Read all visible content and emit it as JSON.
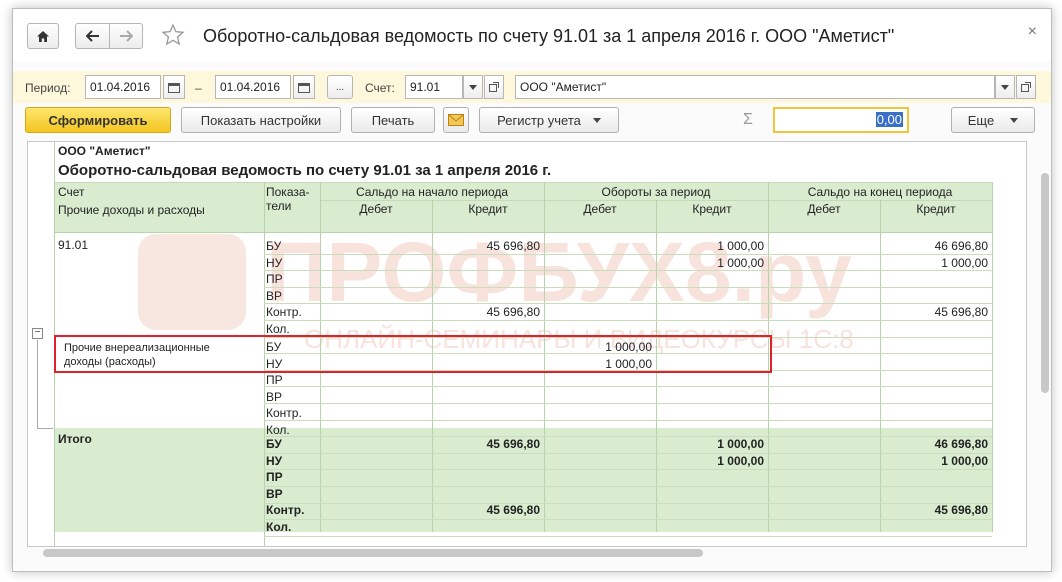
{
  "window": {
    "title": "Оборотно-сальдовая ведомость по счету 91.01 за 1 апреля 2016 г. ООО \"Аметист\""
  },
  "params": {
    "period_label": "Период:",
    "date_from": "01.04.2016",
    "dash": "–",
    "date_to": "01.04.2016",
    "ellipsis": "...",
    "account_label": "Счет:",
    "account_value": "91.01",
    "org_value": "ООО \"Аметист\""
  },
  "toolbar": {
    "generate": "Сформировать",
    "show_settings": "Показать настройки",
    "print": "Печать",
    "register": "Регистр учета",
    "sigma": "Σ",
    "sum_value": "0,00",
    "more": "Еще"
  },
  "report": {
    "org": "ООО \"Аметист\"",
    "title": "Оборотно-сальдовая ведомость по счету 91.01 за 1 апреля 2016 г.",
    "headers": {
      "account": "Счет",
      "subconto": "Прочие доходы и расходы",
      "indicators_1": "Показа-",
      "indicators_2": "тели",
      "opening": "Сальдо на начало периода",
      "turnover": "Обороты за период",
      "closing": "Сальдо на конец периода",
      "debit": "Дебет",
      "credit": "Кредит"
    },
    "group1": {
      "name": "91.01",
      "rows": [
        {
          "ind": "БУ",
          "op_cr": "45 696,80",
          "tu_cr": "1 000,00",
          "cl_cr": "46 696,80"
        },
        {
          "ind": "НУ",
          "op_cr": "",
          "tu_cr": "1 000,00",
          "cl_cr": "1 000,00"
        },
        {
          "ind": "ПР",
          "op_cr": "",
          "tu_cr": "",
          "cl_cr": ""
        },
        {
          "ind": "ВР",
          "op_cr": "",
          "tu_cr": "",
          "cl_cr": ""
        },
        {
          "ind": "Контр.",
          "op_cr": "45 696,80",
          "tu_cr": "",
          "cl_cr": "45 696,80"
        },
        {
          "ind": "Кол.",
          "op_cr": "",
          "tu_cr": "",
          "cl_cr": ""
        }
      ]
    },
    "group2": {
      "name_1": "Прочие внереализационные",
      "name_2": "доходы (расходы)",
      "rows": [
        {
          "ind": "БУ",
          "tu_dr": "1 000,00"
        },
        {
          "ind": "НУ",
          "tu_dr": "1 000,00"
        },
        {
          "ind": "ПР",
          "tu_dr": ""
        },
        {
          "ind": "ВР",
          "tu_dr": ""
        },
        {
          "ind": "Контр.",
          "tu_dr": ""
        },
        {
          "ind": "Кол.",
          "tu_dr": ""
        }
      ]
    },
    "total": {
      "name": "Итого",
      "rows": [
        {
          "ind": "БУ",
          "op_cr": "45 696,80",
          "tu_cr": "1 000,00",
          "cl_cr": "46 696,80"
        },
        {
          "ind": "НУ",
          "op_cr": "",
          "tu_cr": "1 000,00",
          "cl_cr": "1 000,00"
        },
        {
          "ind": "ПР",
          "op_cr": "",
          "tu_cr": "",
          "cl_cr": ""
        },
        {
          "ind": "ВР",
          "op_cr": "",
          "tu_cr": "",
          "cl_cr": ""
        },
        {
          "ind": "Контр.",
          "op_cr": "45 696,80",
          "tu_cr": "",
          "cl_cr": "45 696,80"
        },
        {
          "ind": "Кол.",
          "op_cr": "",
          "tu_cr": "",
          "cl_cr": ""
        }
      ]
    },
    "collapse_sign": "−"
  },
  "watermark": {
    "main": "ПРОФБУХ8.ру",
    "sub": "ОНЛАЙН-СЕМИНАРЫ И ВИДЕОКУРСЫ 1С:8"
  }
}
